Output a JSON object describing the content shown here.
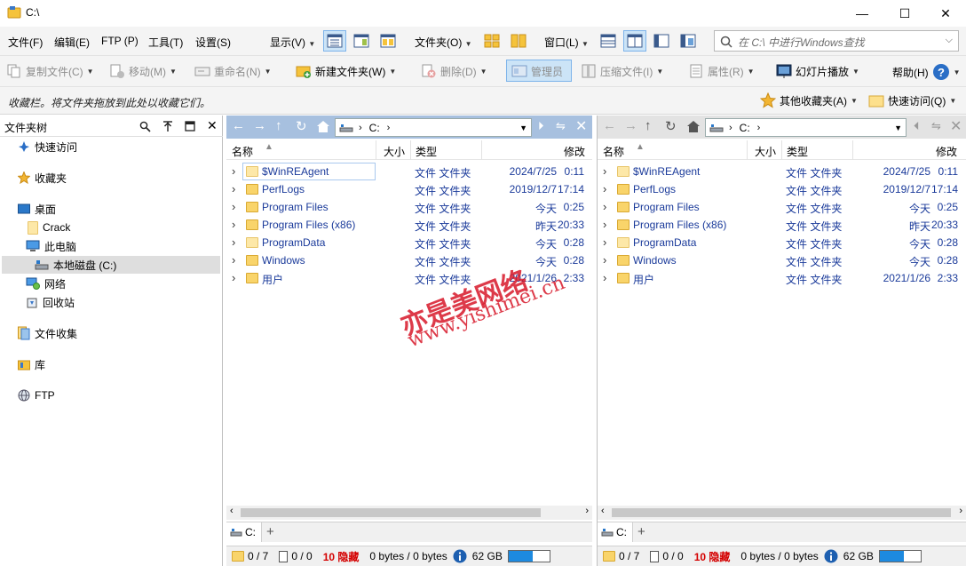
{
  "window": {
    "title": "C:\\",
    "controls": {
      "minimize": "—",
      "maximize": "☐",
      "close": "✕"
    }
  },
  "menu": {
    "items": [
      "文件(F)",
      "编辑(E)",
      "FTP (P)",
      "工具(T)",
      "设置(S)"
    ],
    "view": "显示(V)",
    "folder": "文件夹(O)",
    "window": "窗口(L)"
  },
  "search": {
    "placeholder": "在 C:\\ 中进行Windows查找"
  },
  "toolbar": {
    "copy": "复制文件(C)",
    "move": "移动(M)",
    "rename": "重命名(N)",
    "newfolder": "新建文件夹(W)",
    "delete": "删除(D)",
    "admin": "管理员",
    "compress": "压缩文件(I)",
    "properties": "属性(R)",
    "slideshow": "幻灯片播放",
    "help": "帮助(H)"
  },
  "favbar": {
    "hint": "收藏栏。将文件夹拖放到此处以收藏它们。",
    "other": "其他收藏夹(A)",
    "quick": "快速访问(Q)"
  },
  "tree": {
    "title": "文件夹树",
    "items": [
      {
        "label": "快速访问",
        "icon": "pin-icon"
      },
      {
        "label": "收藏夹",
        "icon": "star-icon"
      },
      {
        "label": "桌面",
        "icon": "desktop-icon"
      },
      {
        "label": "Crack",
        "icon": "folder-icon"
      },
      {
        "label": "此电脑",
        "icon": "computer-icon"
      },
      {
        "label": "本地磁盘 (C:)",
        "icon": "drive-icon"
      },
      {
        "label": "网络",
        "icon": "network-icon"
      },
      {
        "label": "回收站",
        "icon": "recycle-bin-icon"
      },
      {
        "label": "文件收集",
        "icon": "collection-icon"
      },
      {
        "label": "库",
        "icon": "library-icon"
      },
      {
        "label": "FTP",
        "icon": "ftp-icon"
      }
    ]
  },
  "panes": [
    {
      "address": "C:",
      "columns": {
        "name": "名称",
        "size": "大小",
        "type": "类型",
        "modified": "修改"
      },
      "rows": [
        {
          "name": "$WinREAgent",
          "type": "文件 文件夹",
          "date": "2024/7/25",
          "time": "0:11"
        },
        {
          "name": "PerfLogs",
          "type": "文件 文件夹",
          "date": "2019/12/7",
          "time": "17:14"
        },
        {
          "name": "Program Files",
          "type": "文件 文件夹",
          "date": "今天",
          "time": "0:25"
        },
        {
          "name": "Program Files (x86)",
          "type": "文件 文件夹",
          "date": "昨天",
          "time": "20:33"
        },
        {
          "name": "ProgramData",
          "type": "文件 文件夹",
          "date": "今天",
          "time": "0:28"
        },
        {
          "name": "Windows",
          "type": "文件 文件夹",
          "date": "今天",
          "time": "0:28"
        },
        {
          "name": "用户",
          "type": "文件 文件夹",
          "date": "2021/1/26",
          "time": "2:33"
        }
      ],
      "tab": "C:",
      "status": {
        "folders": "0 / 7",
        "files": "0 / 0",
        "hidden": "10 隐藏",
        "bytes": "0 bytes / 0 bytes",
        "free": "62 GB"
      }
    },
    {
      "address": "C:",
      "columns": {
        "name": "名称",
        "size": "大小",
        "type": "类型",
        "modified": "修改"
      },
      "rows": [
        {
          "name": "$WinREAgent",
          "type": "文件 文件夹",
          "date": "2024/7/25",
          "time": "0:11"
        },
        {
          "name": "PerfLogs",
          "type": "文件 文件夹",
          "date": "2019/12/7",
          "time": "17:14"
        },
        {
          "name": "Program Files",
          "type": "文件 文件夹",
          "date": "今天",
          "time": "0:25"
        },
        {
          "name": "Program Files (x86)",
          "type": "文件 文件夹",
          "date": "昨天",
          "time": "20:33"
        },
        {
          "name": "ProgramData",
          "type": "文件 文件夹",
          "date": "今天",
          "time": "0:28"
        },
        {
          "name": "Windows",
          "type": "文件 文件夹",
          "date": "今天",
          "time": "0:28"
        },
        {
          "name": "用户",
          "type": "文件 文件夹",
          "date": "2021/1/26",
          "time": "2:33"
        }
      ],
      "tab": "C:",
      "status": {
        "folders": "0 / 7",
        "files": "0 / 0",
        "hidden": "10 隐藏",
        "bytes": "0 bytes / 0 bytes",
        "free": "62 GB"
      }
    }
  ],
  "watermark": {
    "line1": "亦是美网络",
    "line2": "www.yishimei.cn"
  },
  "colors": {
    "accent": "#a7c0df",
    "hidden": "#d40000",
    "link": "#1a3a9a",
    "selected": "#cce4f7"
  }
}
